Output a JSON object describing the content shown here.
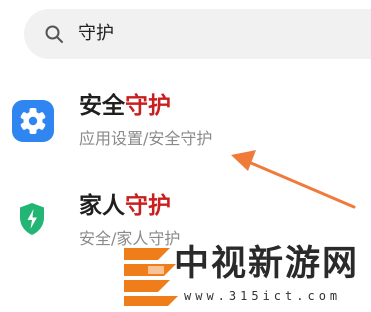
{
  "search": {
    "query": "守护",
    "icon": "search-icon"
  },
  "results": [
    {
      "icon": "gear-icon",
      "icon_color": "#2f86f0",
      "title_prefix": "安全",
      "title_highlight": "守护",
      "subtitle": "应用设置/安全守护"
    },
    {
      "icon": "shield-icon",
      "icon_color": "#22b573",
      "title_prefix": "家人",
      "title_highlight": "守护",
      "subtitle": "安全/家人守护"
    }
  ],
  "annotation": {
    "icon": "arrow-icon",
    "color": "#f07a3a"
  },
  "watermark": {
    "title": "中视新游网",
    "url": "www.315ict.com",
    "logo_color": "#ef7d1a"
  },
  "colors": {
    "highlight": "#c81f1f",
    "subtitle": "#8a8a8a"
  }
}
